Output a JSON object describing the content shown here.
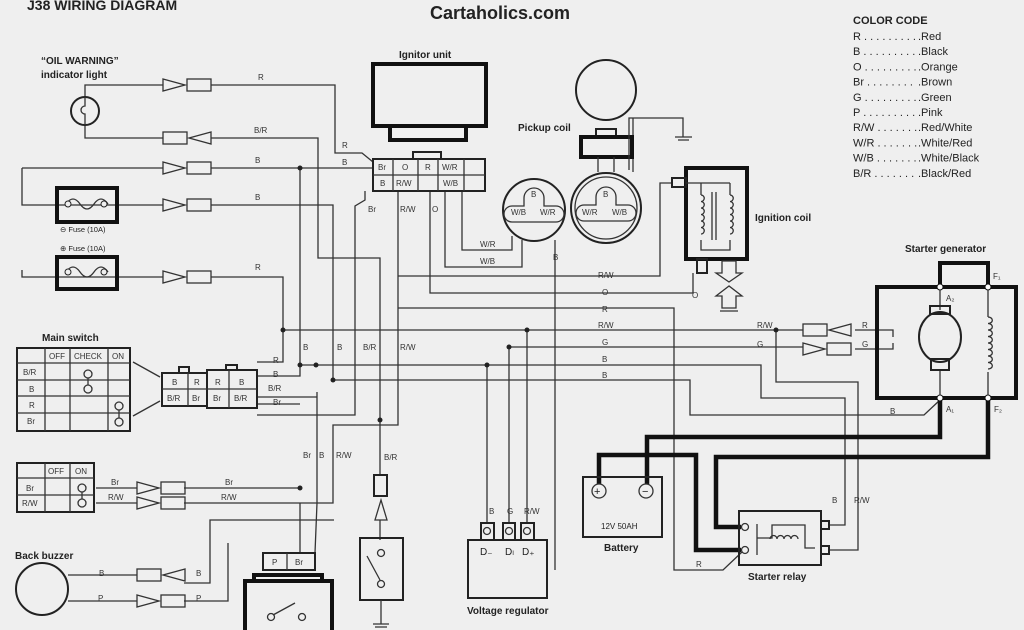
{
  "title": "J38 WIRING DIAGRAM",
  "watermark": "Cartaholics.com",
  "components": {
    "oil_warning_line1": "“OIL WARNING”",
    "oil_warning_line2": "indicator light",
    "fuse_negative": "⊖ Fuse (10A)",
    "fuse_positive": "⊕ Fuse (10A)",
    "ignitor_unit": "Ignitor unit",
    "pickup_coil": "Pickup coil",
    "ignition_coil": "Ignition coil",
    "starter_generator": "Starter generator",
    "main_switch": "Main switch",
    "back_buzzer": "Back buzzer",
    "battery": "Battery",
    "battery_rating": "12V 50AH",
    "starter_relay": "Starter relay",
    "voltage_regulator": "Voltage regulator"
  },
  "terminals": {
    "a2": "A₂",
    "f1": "F₁",
    "a1": "A₁",
    "f2": "F₂",
    "d_minus": "D₋",
    "d_g": "Dₗ",
    "d_plus": "D₊",
    "battery_plus": "+",
    "battery_minus": "−"
  },
  "ignitor_connector": {
    "row1": [
      "Br",
      "O",
      "R",
      "W/R",
      ""
    ],
    "row2": [
      "B",
      "R/W",
      "",
      "W/B",
      ""
    ]
  },
  "pickup_plug_left": [
    "B",
    "W/B",
    "W/R"
  ],
  "pickup_plug_right": [
    "B",
    "W/R",
    "W/B"
  ],
  "main_switch_table": {
    "headers": [
      "",
      "OFF",
      "CHECK",
      "ON"
    ],
    "rows": [
      "B/R",
      "B",
      "R",
      "Br"
    ]
  },
  "main_switch_connector": {
    "left": [
      "B",
      "R",
      "B/R",
      "Br"
    ],
    "right": [
      "R",
      "B",
      "Br",
      "B/R"
    ]
  },
  "light_switch_table": {
    "headers": [
      "",
      "OFF",
      "ON"
    ],
    "rows": [
      "Br",
      "R/W"
    ]
  },
  "bottom_connector": [
    "P",
    "Br"
  ],
  "color_code": {
    "title": "COLOR CODE",
    "entries": [
      {
        "code": "R",
        "name": "Red"
      },
      {
        "code": "B",
        "name": "Black"
      },
      {
        "code": "O",
        "name": "Orange"
      },
      {
        "code": "Br",
        "name": "Brown"
      },
      {
        "code": "G",
        "name": "Green"
      },
      {
        "code": "P",
        "name": "Pink"
      },
      {
        "code": "R/W",
        "name": "Red/White"
      },
      {
        "code": "W/R",
        "name": "White/Red"
      },
      {
        "code": "W/B",
        "name": "White/Black"
      },
      {
        "code": "B/R",
        "name": "Black/Red"
      }
    ]
  },
  "wire_labels": [
    "R",
    "B/R",
    "R",
    "B",
    "B",
    "B",
    "R",
    "Br",
    "R/W",
    "O",
    "W/R",
    "W/B",
    "B",
    "R/W",
    "O",
    "O",
    "R",
    "R/W",
    "R/W",
    "R",
    "G",
    "G",
    "G",
    "B",
    "B",
    "B",
    "R",
    "B",
    "B/R",
    "Br",
    "B",
    "B",
    "B/R",
    "R/W",
    "Br",
    "B",
    "R/W",
    "B/R",
    "Br",
    "R/W",
    "Br",
    "R/W",
    "B",
    "P",
    "B",
    "P",
    "B",
    "G",
    "R/W",
    "B",
    "R/W",
    "R"
  ]
}
